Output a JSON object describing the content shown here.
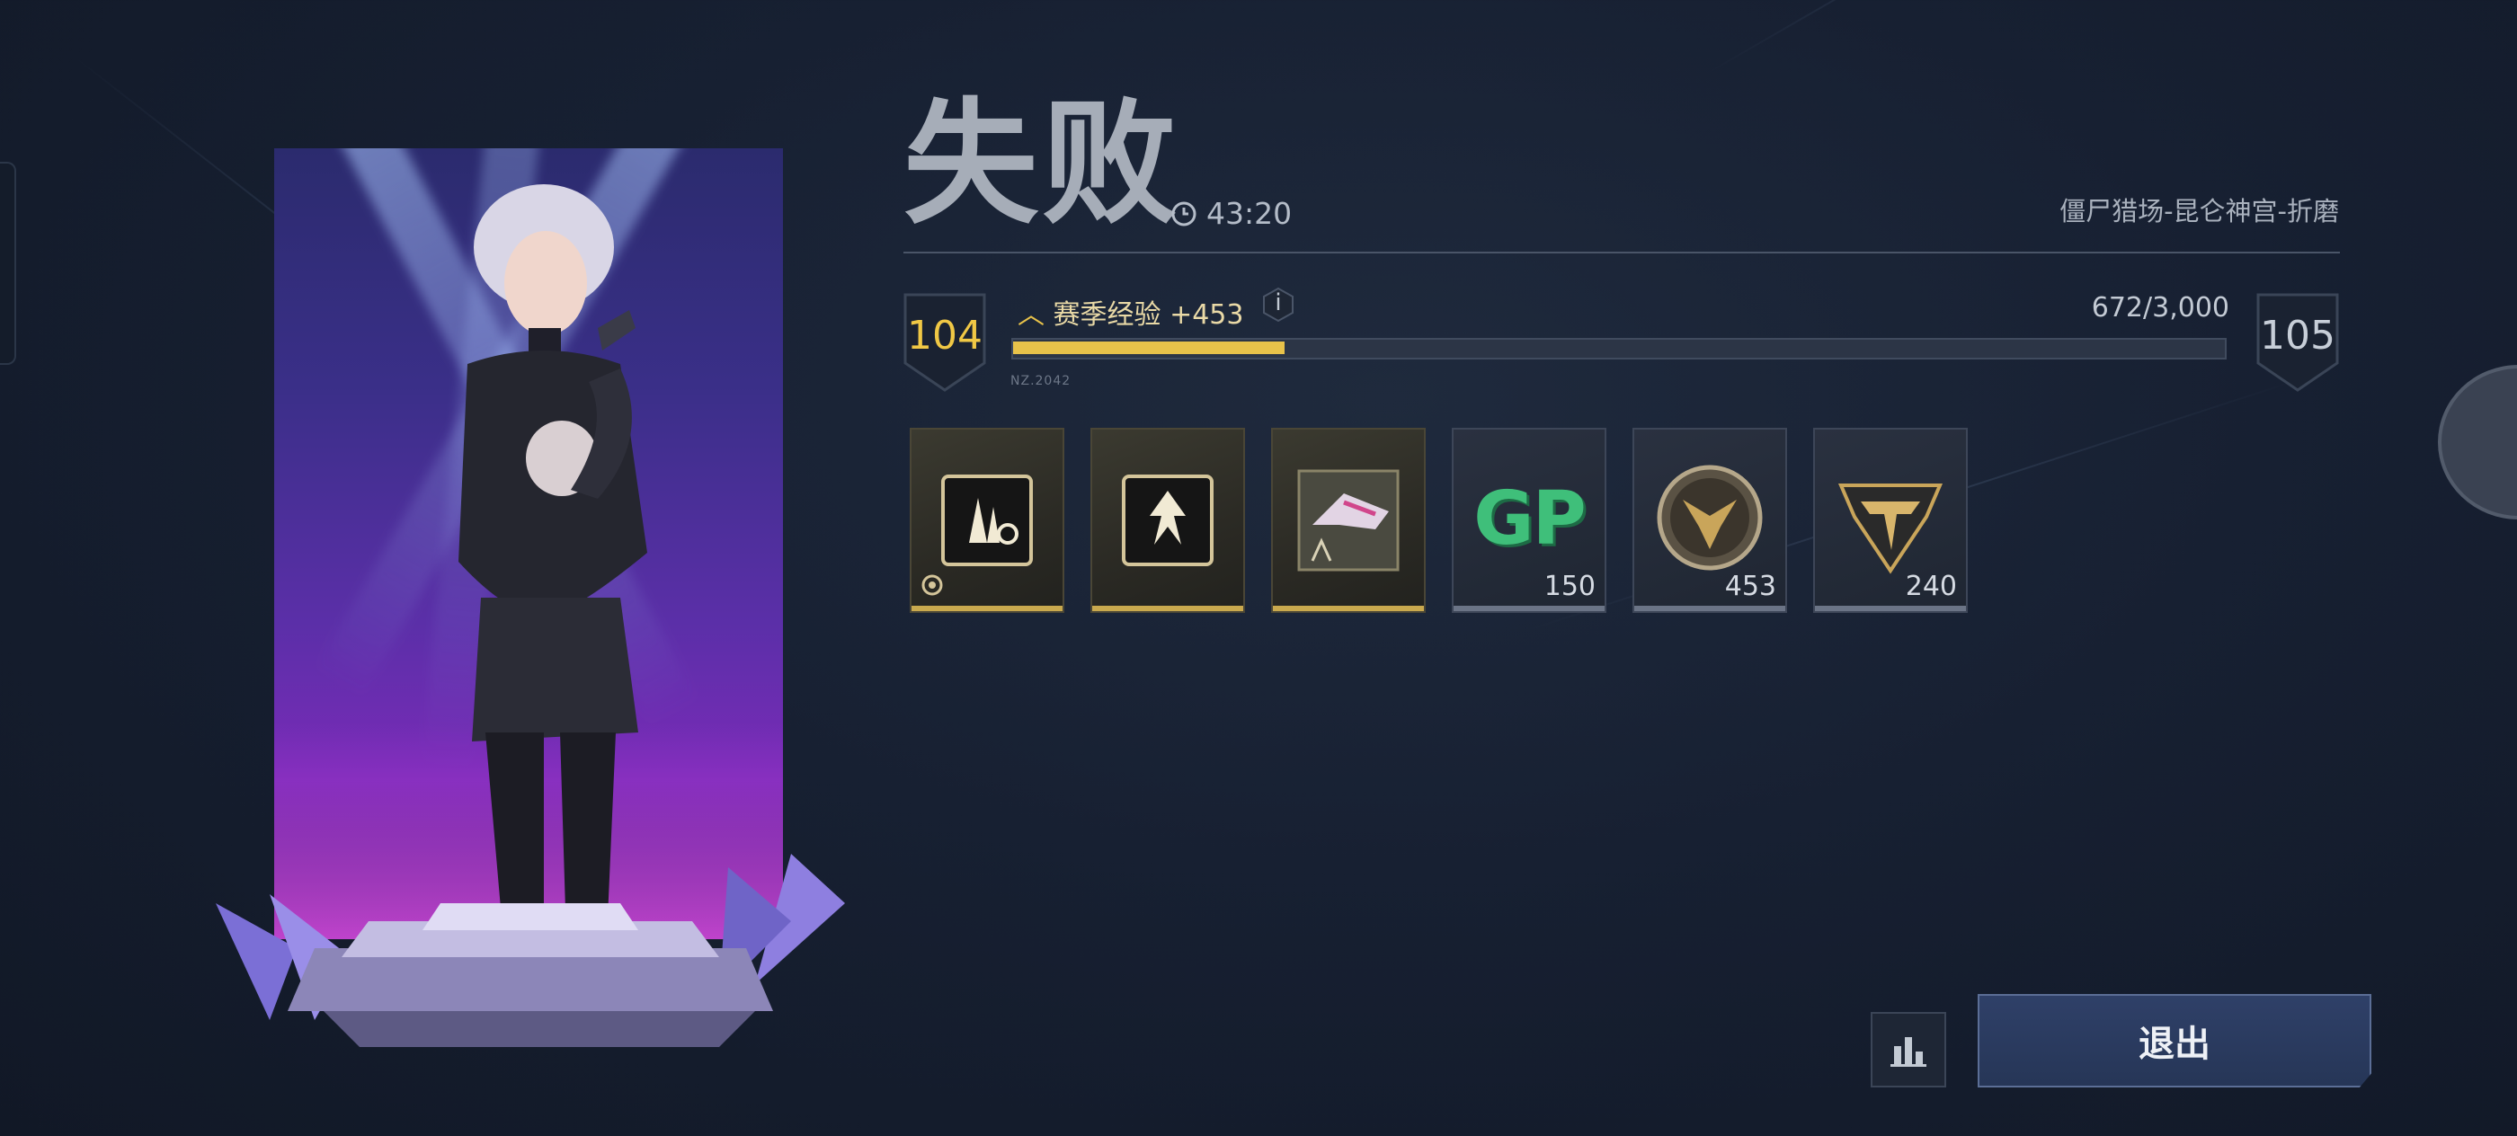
{
  "result": {
    "title": "失败",
    "time": "43:20",
    "mode": "僵尸猎场-昆仑神宫-折磨"
  },
  "xp": {
    "current_level": "104",
    "next_level": "105",
    "label": "赛季经验 +453",
    "progress_text": "672/3,000",
    "progress_fraction": 0.224,
    "info_label": "i",
    "tag": "NZ.2042"
  },
  "rewards": [
    {
      "name": "weapon-part-crate-icon",
      "qty": ""
    },
    {
      "name": "emblem-crate-icon",
      "qty": ""
    },
    {
      "name": "weapon-skin-blueprint-icon",
      "qty": ""
    },
    {
      "name": "gp-currency-icon",
      "label": "GP",
      "qty": "150"
    },
    {
      "name": "season-coin-icon",
      "qty": "453"
    },
    {
      "name": "rank-badge-icon",
      "qty": "240"
    }
  ],
  "buttons": {
    "exit": "退出",
    "stats_icon": "bar-chart-icon"
  },
  "colors": {
    "accent_gold": "#e8c24a",
    "exit_button": "#2f4068",
    "gp_green": "#3fbf7a"
  }
}
